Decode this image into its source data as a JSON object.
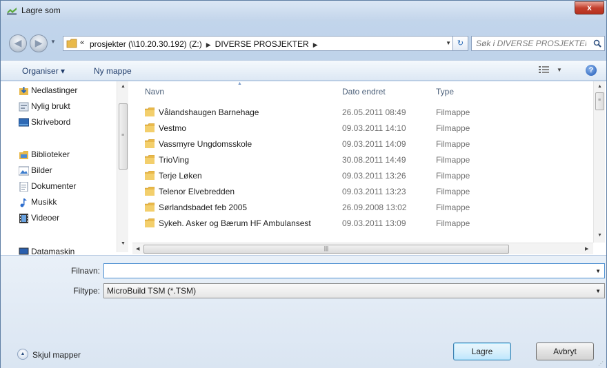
{
  "window": {
    "title": "Lagre som",
    "close_label": "x"
  },
  "navbar": {
    "address_prefix": "«",
    "address_segments": [
      "prosjekter (\\\\10.20.30.192) (Z:)",
      "DIVERSE PROSJEKTER"
    ],
    "search_placeholder": "Søk i DIVERSE PROSJEKTER"
  },
  "toolbar": {
    "organize_label": "Organiser ▾",
    "new_folder_label": "Ny mappe"
  },
  "nav_pane": {
    "items": [
      {
        "label": "Nedlastinger",
        "icon": "downloads-icon"
      },
      {
        "label": "Nylig brukt",
        "icon": "recent-places-icon"
      },
      {
        "label": "Skrivebord",
        "icon": "desktop-icon"
      },
      {
        "label": "Biblioteker",
        "icon": "libraries-icon"
      },
      {
        "label": "Bilder",
        "icon": "pictures-icon"
      },
      {
        "label": "Dokumenter",
        "icon": "documents-icon"
      },
      {
        "label": "Musikk",
        "icon": "music-icon"
      },
      {
        "label": "Videoer",
        "icon": "videos-icon"
      },
      {
        "label": "Datamaskin",
        "icon": "computer-icon"
      }
    ]
  },
  "file_list": {
    "columns": {
      "name": "Navn",
      "date": "Dato endret",
      "type": "Type"
    },
    "rows": [
      {
        "name": "Vålandshaugen Barnehage",
        "date": "26.05.2011 08:49",
        "type": "Filmappe"
      },
      {
        "name": "Vestmo",
        "date": "09.03.2011 14:10",
        "type": "Filmappe"
      },
      {
        "name": "Vassmyre Ungdomsskole",
        "date": "09.03.2011 14:09",
        "type": "Filmappe"
      },
      {
        "name": "TrioVing",
        "date": "30.08.2011 14:49",
        "type": "Filmappe"
      },
      {
        "name": "Terje Løken",
        "date": "09.03.2011 13:26",
        "type": "Filmappe"
      },
      {
        "name": "Telenor Elvebredden",
        "date": "09.03.2011 13:23",
        "type": "Filmappe"
      },
      {
        "name": "Sørlandsbadet feb 2005",
        "date": "26.09.2008 13:02",
        "type": "Filmappe"
      },
      {
        "name": "Sykeh. Asker og Bærum HF Ambulansest",
        "date": "09.03.2011 13:09",
        "type": "Filmappe"
      }
    ]
  },
  "form": {
    "filename_label": "Filnavn:",
    "filename_value": "",
    "filetype_label": "Filtype:",
    "filetype_value": "MicroBuild TSM (*.TSM)",
    "hide_folders_label": "Skjul mapper",
    "save_label": "Lagre",
    "cancel_label": "Avbryt"
  },
  "colors": {
    "folder": "#e9b94a",
    "accent": "#3c7fb1"
  }
}
